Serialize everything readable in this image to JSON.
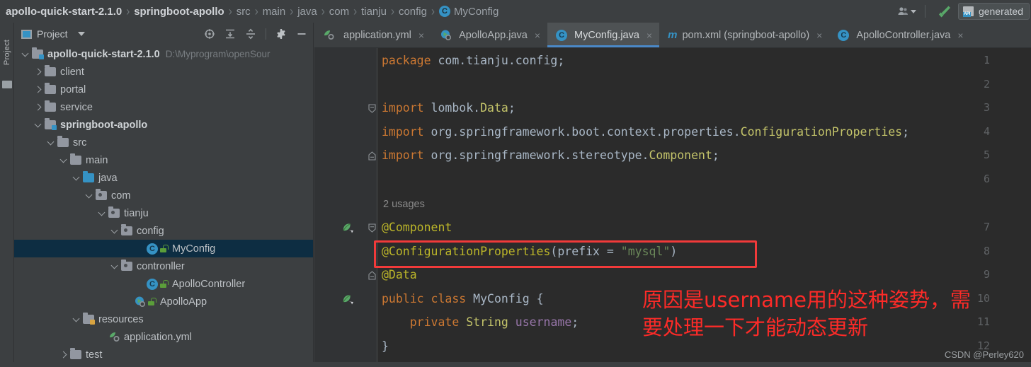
{
  "window": {
    "theme_bg": "#3c3f41",
    "editor_bg": "#2b2b2b",
    "accent": "#3592c4",
    "annotation_red": "#fc2b28",
    "highlight_box": "#f13a3a"
  },
  "breadcrumb": {
    "items": [
      {
        "label": "apollo-quick-start-2.1.0",
        "bold": true
      },
      {
        "label": "springboot-apollo",
        "bold": true
      },
      {
        "label": "src",
        "bold": false
      },
      {
        "label": "main",
        "bold": false
      },
      {
        "label": "java",
        "bold": false
      },
      {
        "label": "com",
        "bold": false
      },
      {
        "label": "tianju",
        "bold": false
      },
      {
        "label": "config",
        "bold": false
      },
      {
        "label": "MyConfig",
        "bold": false,
        "icon": "class-icon",
        "icon_letter": "C"
      }
    ],
    "separator": "›"
  },
  "toolbar_right": {
    "user_icon": "user-account-icon",
    "user_caret": "chevron-down-icon",
    "build_icon": "build-hammer-icon",
    "generate_button": {
      "label": "generated",
      "icon": "api-generate-icon"
    }
  },
  "tool_strip": {
    "project_tab_label": "Project"
  },
  "project_panel": {
    "title": "Project",
    "title_icon": "project-view-icon",
    "dropdown_icon": "chevron-down-icon",
    "tools": [
      {
        "name": "scroll-from-source-icon"
      },
      {
        "name": "expand-all-icon"
      },
      {
        "name": "collapse-all-icon"
      },
      {
        "name": "settings-gear-icon"
      },
      {
        "name": "hide-panel-icon"
      }
    ],
    "tree": [
      {
        "label": "apollo-quick-start-2.1.0",
        "path": "D:\\Myprogram\\openSour",
        "depth": 0,
        "arrow": "down",
        "icon": "module-folder-icon",
        "bold": true,
        "selected": false
      },
      {
        "label": "client",
        "depth": 1,
        "arrow": "right",
        "icon": "folder-icon",
        "bold": false,
        "selected": false
      },
      {
        "label": "portal",
        "depth": 1,
        "arrow": "right",
        "icon": "folder-icon",
        "bold": false,
        "selected": false
      },
      {
        "label": "service",
        "depth": 1,
        "arrow": "right",
        "icon": "folder-icon",
        "bold": false,
        "selected": false
      },
      {
        "label": "springboot-apollo",
        "depth": 1,
        "arrow": "down",
        "icon": "module-folder-icon",
        "bold": true,
        "selected": false
      },
      {
        "label": "src",
        "depth": 2,
        "arrow": "down",
        "icon": "folder-icon",
        "bold": false,
        "selected": false
      },
      {
        "label": "main",
        "depth": 3,
        "arrow": "down",
        "icon": "folder-icon",
        "bold": false,
        "selected": false
      },
      {
        "label": "java",
        "depth": 4,
        "arrow": "down",
        "icon": "source-root-folder-icon",
        "bold": false,
        "selected": false
      },
      {
        "label": "com",
        "depth": 5,
        "arrow": "down",
        "icon": "package-folder-icon",
        "bold": false,
        "selected": false
      },
      {
        "label": "tianju",
        "depth": 6,
        "arrow": "down",
        "icon": "package-folder-icon",
        "bold": false,
        "selected": false
      },
      {
        "label": "config",
        "depth": 7,
        "arrow": "down",
        "icon": "package-folder-icon",
        "bold": false,
        "selected": false
      },
      {
        "label": "MyConfig",
        "depth": 9,
        "arrow": "none",
        "icon": "java-class-icon",
        "bold": false,
        "selected": true
      },
      {
        "label": "contronller",
        "depth": 7,
        "arrow": "down",
        "icon": "package-folder-icon",
        "bold": false,
        "selected": false
      },
      {
        "label": "ApolloController",
        "depth": 9,
        "arrow": "none",
        "icon": "java-class-icon",
        "bold": false,
        "selected": false
      },
      {
        "label": "ApolloApp",
        "depth": 8,
        "arrow": "none",
        "icon": "spring-boot-class-icon",
        "bold": false,
        "selected": false
      },
      {
        "label": "resources",
        "depth": 4,
        "arrow": "down",
        "icon": "resources-folder-icon",
        "bold": false,
        "selected": false
      },
      {
        "label": "application.yml",
        "depth": 6,
        "arrow": "none",
        "icon": "spring-yaml-icon",
        "bold": false,
        "selected": false
      },
      {
        "label": "test",
        "depth": 3,
        "arrow": "right",
        "icon": "folder-icon",
        "bold": false,
        "selected": false
      }
    ]
  },
  "editor_tabs": [
    {
      "label": "application.yml",
      "icon": "spring-yaml-icon",
      "active": false,
      "close": "×"
    },
    {
      "label": "ApolloApp.java",
      "icon": "spring-boot-class-icon",
      "active": false,
      "close": "×"
    },
    {
      "label": "MyConfig.java",
      "icon": "java-class-icon",
      "active": true,
      "close": "×"
    },
    {
      "label": "pom.xml (springboot-apollo)",
      "icon": "maven-icon",
      "active": false,
      "close": "×"
    },
    {
      "label": "ApolloController.java",
      "icon": "java-class-icon",
      "active": false,
      "close": "×"
    }
  ],
  "editor": {
    "line_numbers": [
      "1",
      "2",
      "3",
      "4",
      "5",
      "6",
      "7",
      "8",
      "9",
      "10",
      "11",
      "12"
    ],
    "inlay_hint": "2 usages",
    "gutter_run_markers": [
      {
        "line": 7,
        "name": "spring-bean-gutter-icon"
      },
      {
        "line": 10,
        "name": "spring-bean-gutter-icon"
      }
    ],
    "fold_markers": [
      {
        "line": 3,
        "type": "fold-start"
      },
      {
        "line": 5,
        "type": "fold-end"
      },
      {
        "line": 7,
        "type": "fold-start"
      },
      {
        "line": 9,
        "type": "fold-end"
      }
    ],
    "code_lines": [
      {
        "line": 1,
        "tokens": [
          {
            "t": "package",
            "c": "kw"
          },
          {
            "t": " com.tianju.config;",
            "c": "pl"
          }
        ]
      },
      {
        "line": 2,
        "tokens": []
      },
      {
        "line": 3,
        "tokens": [
          {
            "t": "import",
            "c": "kw"
          },
          {
            "t": " lombok.",
            "c": "pl"
          },
          {
            "t": "Data",
            "c": "cls"
          },
          {
            "t": ";",
            "c": "pl"
          }
        ]
      },
      {
        "line": 4,
        "tokens": [
          {
            "t": "import",
            "c": "kw"
          },
          {
            "t": " org.springframework.boot.context.properties.",
            "c": "pl"
          },
          {
            "t": "ConfigurationProperties",
            "c": "cls"
          },
          {
            "t": ";",
            "c": "pl"
          }
        ]
      },
      {
        "line": 5,
        "tokens": [
          {
            "t": "import",
            "c": "kw"
          },
          {
            "t": " org.springframework.stereotype.",
            "c": "pl"
          },
          {
            "t": "Component",
            "c": "cls"
          },
          {
            "t": ";",
            "c": "pl"
          }
        ]
      },
      {
        "line": 6,
        "tokens": []
      },
      {
        "line": 7,
        "tokens": [
          {
            "t": "@Component",
            "c": "ann"
          }
        ]
      },
      {
        "line": 8,
        "tokens": [
          {
            "t": "@ConfigurationProperties",
            "c": "ann"
          },
          {
            "t": "(",
            "c": "op"
          },
          {
            "t": "prefix",
            "c": "pl"
          },
          {
            "t": " = ",
            "c": "op"
          },
          {
            "t": "\"mysql\"",
            "c": "str"
          },
          {
            "t": ")",
            "c": "op"
          }
        ]
      },
      {
        "line": 9,
        "tokens": [
          {
            "t": "@Data",
            "c": "ann"
          }
        ]
      },
      {
        "line": 10,
        "tokens": [
          {
            "t": "public",
            "c": "kw"
          },
          {
            "t": " ",
            "c": "pl"
          },
          {
            "t": "class",
            "c": "kw"
          },
          {
            "t": " ",
            "c": "pl"
          },
          {
            "t": "MyConfig",
            "c": "pl"
          },
          {
            "t": " {",
            "c": "pl"
          }
        ]
      },
      {
        "line": 11,
        "tokens": [
          {
            "t": "    ",
            "c": "pl"
          },
          {
            "t": "private",
            "c": "kw"
          },
          {
            "t": " ",
            "c": "pl"
          },
          {
            "t": "String",
            "c": "cls"
          },
          {
            "t": " ",
            "c": "pl"
          },
          {
            "t": "username",
            "c": "fld"
          },
          {
            "t": ";",
            "c": "pl"
          }
        ]
      },
      {
        "line": 12,
        "tokens": [
          {
            "t": "}",
            "c": "pl"
          }
        ]
      }
    ]
  },
  "annotations": {
    "red_box_target_line": 8,
    "note_line_1": "原因是username用的这种姿势，需",
    "note_line_2": "要处理一下才能动态更新",
    "watermark": "CSDN @Perley620"
  }
}
